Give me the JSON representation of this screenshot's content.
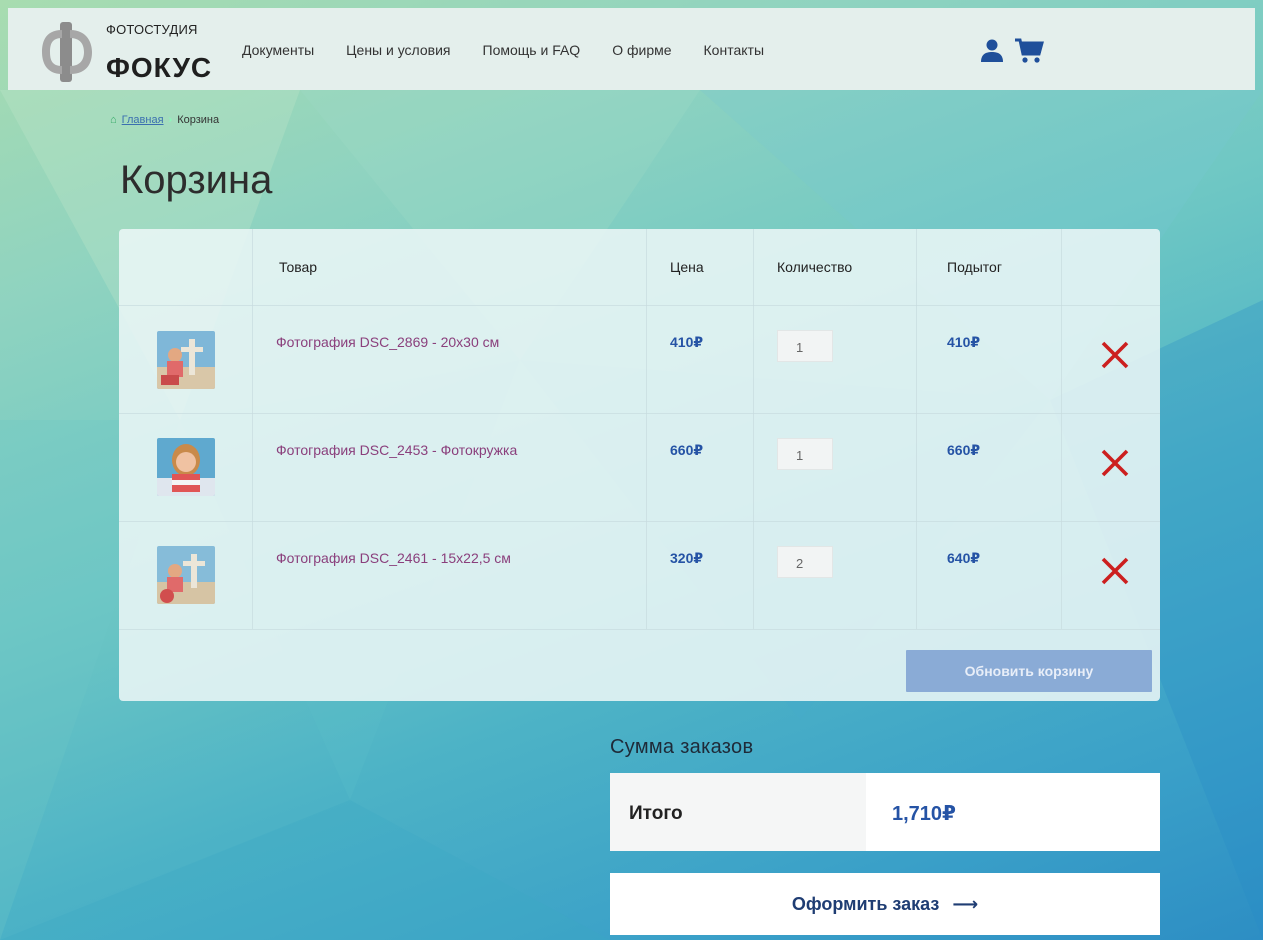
{
  "brand": {
    "top": "ФОТОСТУДИЯ",
    "name": "ФОКУС"
  },
  "nav": [
    "Документы",
    "Цены и условия",
    "Помощь и FAQ",
    "О фирме",
    "Контакты"
  ],
  "header_icons": {
    "user": "user-icon",
    "cart": "cart-icon"
  },
  "breadcrumb": {
    "home_icon": "home-icon",
    "home": "Главная",
    "separator": "›",
    "current": "Корзина"
  },
  "title": "Корзина",
  "cart": {
    "headers": {
      "product": "Товар",
      "price": "Цена",
      "quantity": "Количество",
      "subtotal": "Подытог"
    },
    "items": [
      {
        "name": "Фотография DSC_2869 - 20x30 см",
        "price": "410₽",
        "qty": "1",
        "subtotal": "410₽"
      },
      {
        "name": "Фотография DSC_2453 - Фотокружка",
        "price": "660₽",
        "qty": "1",
        "subtotal": "660₽"
      },
      {
        "name": "Фотография DSC_2461 - 15x22,5 см",
        "price": "320₽",
        "qty": "2",
        "subtotal": "640₽"
      }
    ],
    "update_label": "Обновить корзину"
  },
  "totals": {
    "title": "Сумма заказов",
    "label": "Итого",
    "value": "1,710₽"
  },
  "checkout_label": "Оформить заказ",
  "colors": {
    "accent": "#2553a5",
    "product_link": "#8a3f7c",
    "remove": "#cc1f1f",
    "update_button": "#8aabd6"
  }
}
